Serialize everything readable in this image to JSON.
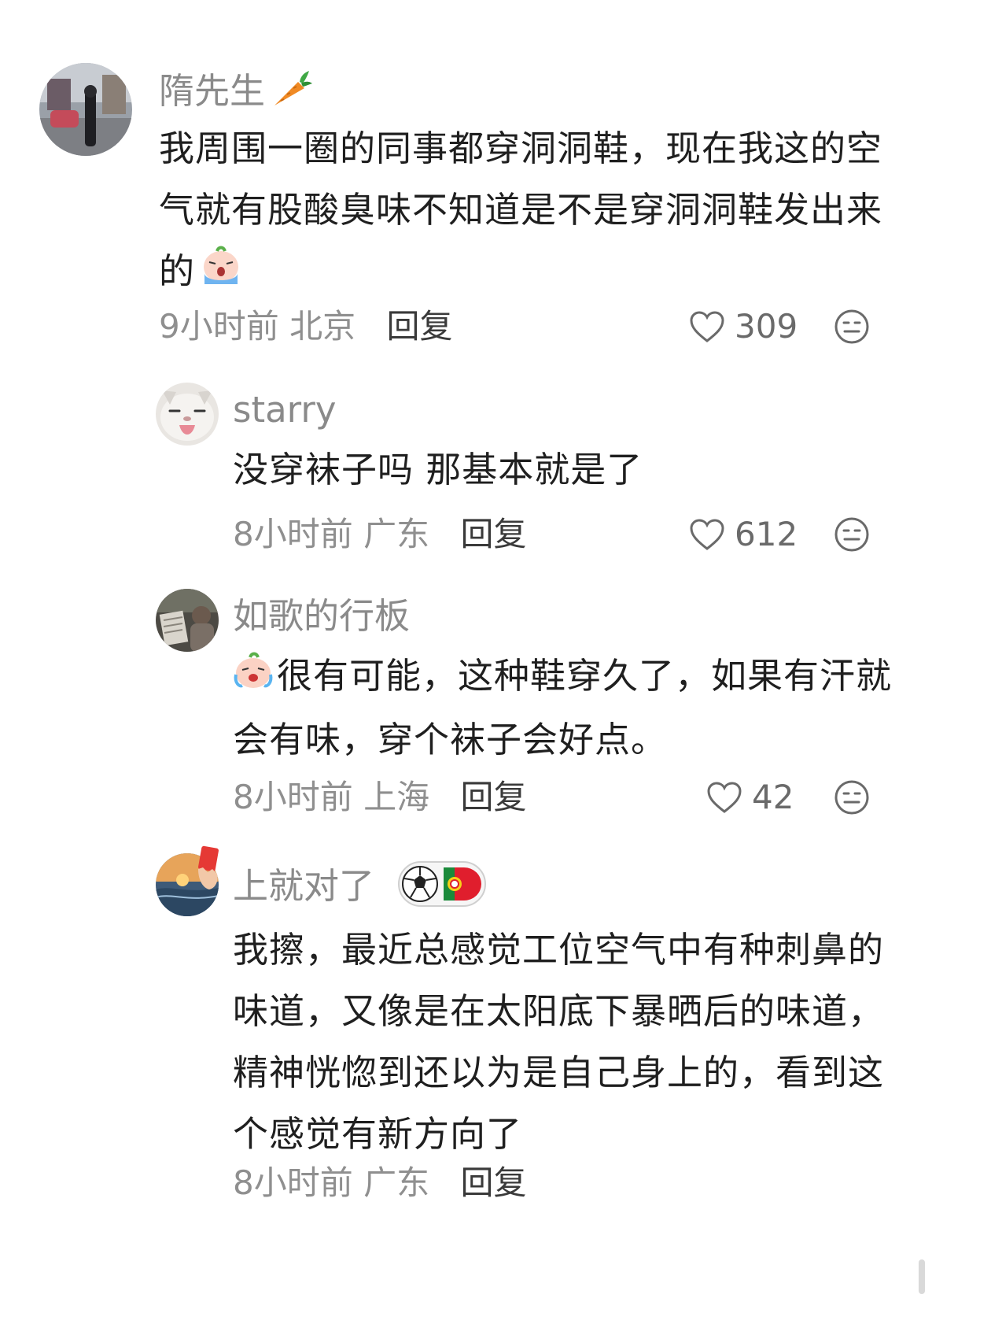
{
  "comments": [
    {
      "username": "隋先生",
      "username_emoji": "carrot-icon",
      "text": "我周围一圈的同事都穿洞洞鞋，现在我这的空气就有股酸臭味不知道是不是穿洞洞鞋发出来的",
      "time": "9小时前",
      "location": "北京",
      "reply": "回复",
      "likes": "309"
    },
    {
      "username": "starry",
      "text": "没穿袜子吗 那基本就是了",
      "time": "8小时前",
      "location": "广东",
      "reply": "回复",
      "likes": "612"
    },
    {
      "username": "如歌的行板",
      "text": "很有可能，这种鞋穿久了，如果有汗就会有味，穿个袜子会好点。",
      "time": "8小时前",
      "location": "上海",
      "reply": "回复",
      "likes": "42"
    },
    {
      "username": "上就对了",
      "username_badge": "soccer-portugal-badge",
      "text": "我擦，最近总感觉工位空气中有种刺鼻的味道，又像是在太阳底下暴晒后的味道，精神恍惚到还以为是自己身上的，看到这个感觉有新方向了",
      "time": "8小时前",
      "location": "广东",
      "reply": "回复"
    }
  ]
}
